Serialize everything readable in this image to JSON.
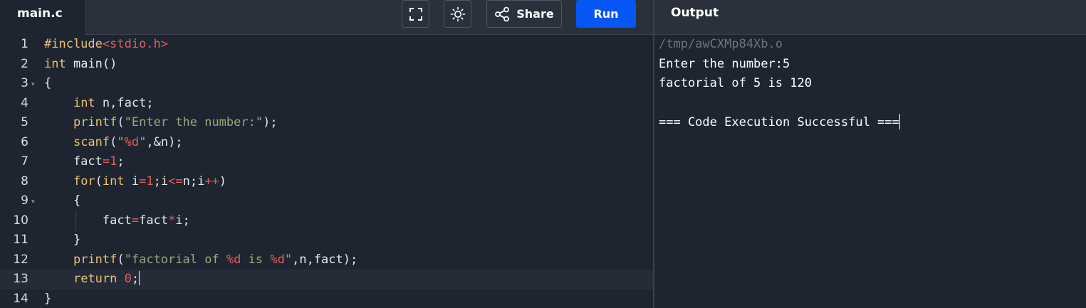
{
  "file_tab": {
    "label": "main.c"
  },
  "toolbar": {
    "fullscreen_icon": "fullscreen-icon",
    "theme_icon": "sun-icon",
    "share_icon": "share-icon",
    "share_label": "Share",
    "run_label": "Run"
  },
  "output_tab": {
    "label": "Output"
  },
  "editor": {
    "active_line": 13,
    "lines": [
      {
        "num": "1",
        "tokens": [
          {
            "t": "#include",
            "c": "pp"
          },
          {
            "t": "<stdio.h>",
            "c": "hdr"
          }
        ]
      },
      {
        "num": "2",
        "tokens": [
          {
            "t": "int",
            "c": "kw"
          },
          {
            "t": " main()",
            "c": "plain"
          }
        ]
      },
      {
        "num": "3",
        "fold": true,
        "tokens": [
          {
            "t": "{",
            "c": "plain"
          }
        ]
      },
      {
        "num": "4",
        "tokens": [
          {
            "t": "    ",
            "c": "plain"
          },
          {
            "t": "int",
            "c": "kw"
          },
          {
            "t": " n,fact;",
            "c": "plain"
          }
        ]
      },
      {
        "num": "5",
        "tokens": [
          {
            "t": "    ",
            "c": "plain"
          },
          {
            "t": "printf",
            "c": "fn"
          },
          {
            "t": "(",
            "c": "plain"
          },
          {
            "t": "\"Enter the number:\"",
            "c": "str"
          },
          {
            "t": ");",
            "c": "plain"
          }
        ]
      },
      {
        "num": "6",
        "tokens": [
          {
            "t": "    ",
            "c": "plain"
          },
          {
            "t": "scanf",
            "c": "fn"
          },
          {
            "t": "(",
            "c": "plain"
          },
          {
            "t": "\"",
            "c": "str"
          },
          {
            "t": "%d",
            "c": "fmt"
          },
          {
            "t": "\"",
            "c": "str"
          },
          {
            "t": ",&n);",
            "c": "plain"
          }
        ]
      },
      {
        "num": "7",
        "tokens": [
          {
            "t": "    fact",
            "c": "plain"
          },
          {
            "t": "=",
            "c": "op"
          },
          {
            "t": "1",
            "c": "num"
          },
          {
            "t": ";",
            "c": "plain"
          }
        ]
      },
      {
        "num": "8",
        "tokens": [
          {
            "t": "    ",
            "c": "plain"
          },
          {
            "t": "for",
            "c": "kw"
          },
          {
            "t": "(",
            "c": "plain"
          },
          {
            "t": "int",
            "c": "kw"
          },
          {
            "t": " i",
            "c": "plain"
          },
          {
            "t": "=",
            "c": "op"
          },
          {
            "t": "1",
            "c": "num"
          },
          {
            "t": ";i",
            "c": "plain"
          },
          {
            "t": "<=",
            "c": "op"
          },
          {
            "t": "n;i",
            "c": "plain"
          },
          {
            "t": "++",
            "c": "op"
          },
          {
            "t": ")",
            "c": "plain"
          }
        ]
      },
      {
        "num": "9",
        "fold": true,
        "tokens": [
          {
            "t": "    {",
            "c": "plain"
          }
        ]
      },
      {
        "num": "10",
        "guide": true,
        "tokens": [
          {
            "t": "        fact",
            "c": "plain"
          },
          {
            "t": "=",
            "c": "op"
          },
          {
            "t": "fact",
            "c": "plain"
          },
          {
            "t": "*",
            "c": "op"
          },
          {
            "t": "i;",
            "c": "plain"
          }
        ]
      },
      {
        "num": "11",
        "tokens": [
          {
            "t": "    }",
            "c": "plain"
          }
        ]
      },
      {
        "num": "12",
        "tokens": [
          {
            "t": "    ",
            "c": "plain"
          },
          {
            "t": "printf",
            "c": "fn"
          },
          {
            "t": "(",
            "c": "plain"
          },
          {
            "t": "\"factorial of ",
            "c": "str"
          },
          {
            "t": "%d",
            "c": "fmt"
          },
          {
            "t": " is ",
            "c": "str"
          },
          {
            "t": "%d",
            "c": "fmt"
          },
          {
            "t": "\"",
            "c": "str"
          },
          {
            "t": ",n,fact);",
            "c": "plain"
          }
        ]
      },
      {
        "num": "13",
        "tokens": [
          {
            "t": "    ",
            "c": "plain"
          },
          {
            "t": "return",
            "c": "kw"
          },
          {
            "t": " ",
            "c": "plain"
          },
          {
            "t": "0",
            "c": "num"
          },
          {
            "t": ";",
            "c": "plain"
          }
        ]
      },
      {
        "num": "14",
        "tokens": [
          {
            "t": "}",
            "c": "plain"
          }
        ]
      }
    ]
  },
  "output": {
    "path": "/tmp/awCXMp84Xb.o",
    "lines": [
      "Enter the number:5",
      "factorial of 5 is 120",
      "",
      "=== Code Execution Successful ==="
    ]
  },
  "colors": {
    "background": "#1e2530",
    "topbar": "#2a313c",
    "run_button": "#0556f3",
    "keyword": "#e9c27a",
    "string": "#9aa67d",
    "number": "#e35d5d"
  }
}
